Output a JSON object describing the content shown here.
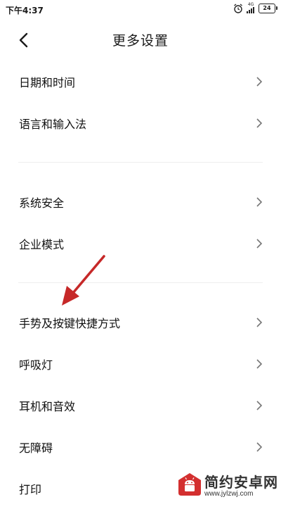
{
  "status_bar": {
    "time": "下午4:37",
    "alarm_icon": "alarm-clock-icon",
    "network_label": "4G",
    "signal_icon": "cellular-signal-icon",
    "battery_level": "24"
  },
  "header": {
    "title": "更多设置",
    "back_icon": "chevron-left-icon"
  },
  "menu": {
    "groups": [
      {
        "items": [
          {
            "label": "日期和时间"
          },
          {
            "label": "语言和输入法"
          }
        ]
      },
      {
        "items": [
          {
            "label": "系统安全"
          },
          {
            "label": "企业模式"
          }
        ]
      },
      {
        "items": [
          {
            "label": "手势及按键快捷方式"
          },
          {
            "label": "呼吸灯"
          },
          {
            "label": "耳机和音效"
          },
          {
            "label": "无障碍"
          },
          {
            "label": "打印"
          }
        ]
      }
    ],
    "chevron_icon": "chevron-right-icon"
  },
  "annotation": {
    "arrow_color": "#c62828",
    "arrow_icon": "red-arrow-annotation"
  },
  "watermark": {
    "title": "简约安卓网",
    "url": "www.jylzwj.com",
    "logo_color": "#d32f2f"
  }
}
